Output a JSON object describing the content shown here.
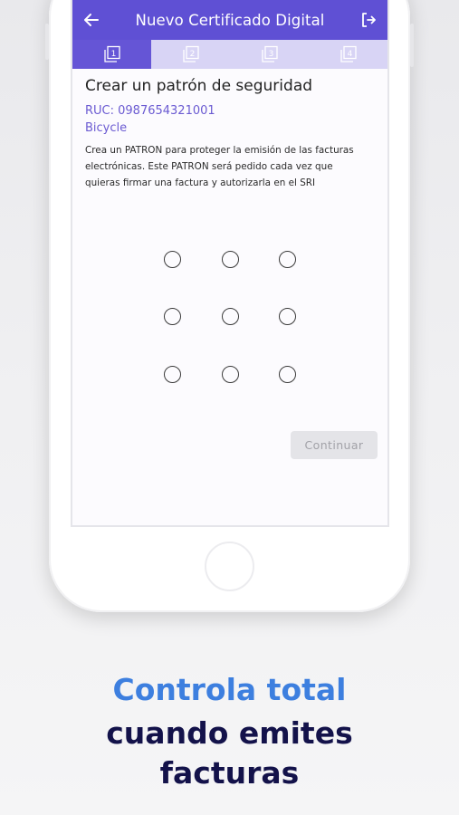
{
  "app_bar": {
    "title": "Nuevo Certificado Digital",
    "back_icon": "arrow-left-icon",
    "logout_icon": "logout-icon",
    "background_color": "#5f50d4"
  },
  "steps": {
    "active_step": 1,
    "items": [
      {
        "number": "1",
        "icon": "step-1-icon"
      },
      {
        "number": "2",
        "icon": "step-2-icon"
      },
      {
        "number": "3",
        "icon": "step-3-icon"
      },
      {
        "number": "4",
        "icon": "step-4-icon"
      }
    ]
  },
  "form": {
    "heading": "Crear un patrón de seguridad",
    "ruc": "RUC: 0987654321001",
    "name": "Bicycle",
    "description": "Crea un PATRON para proteger la emisión de las facturas electrónicas. Este PATRON será pedido cada vez que quieras firmar una factura y autorizarla en el SRI",
    "continue_label": "Continuar",
    "accent_color": "#6b5bd2"
  },
  "promo": {
    "line1": "Controla total",
    "line2": "cuando emites",
    "line3": "facturas",
    "line1_color": "#3d7fdf",
    "line2_color": "#13124a"
  }
}
